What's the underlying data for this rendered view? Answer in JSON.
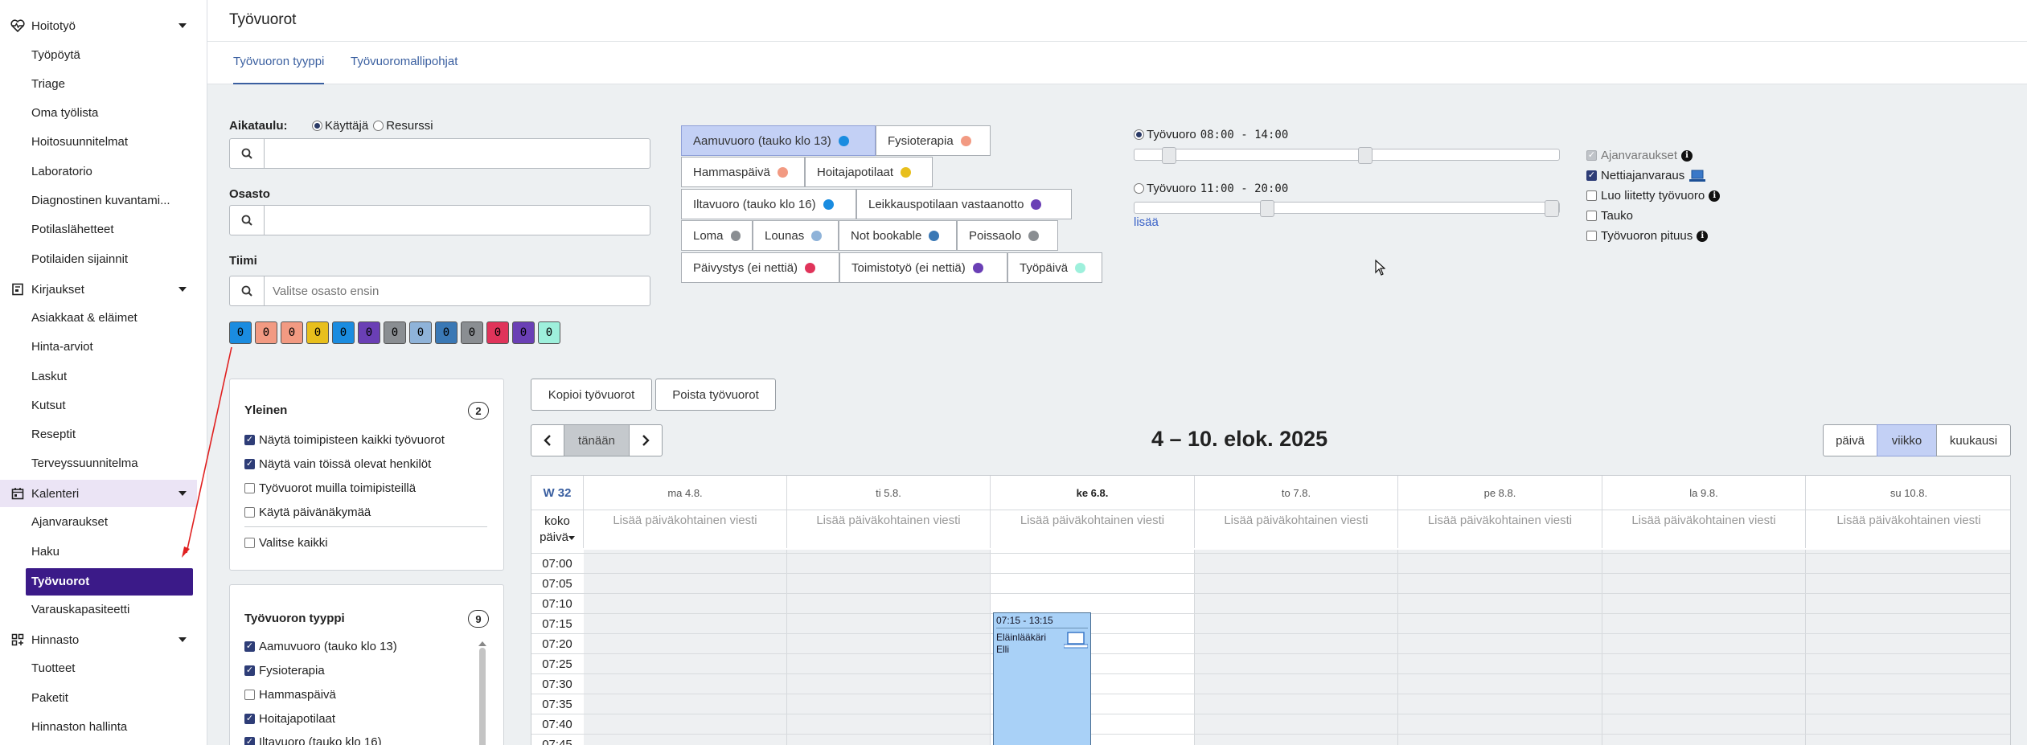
{
  "sidebar": {
    "sections": [
      {
        "label": "Hoitotyö",
        "icon": "heart-pulse-icon"
      },
      {
        "label": "Kirjaukset",
        "icon": "notebook-icon"
      },
      {
        "label": "Kalenteri",
        "icon": "calendar-icon"
      },
      {
        "label": "Hinnasto",
        "icon": "grid-icon"
      }
    ],
    "hoitotyo_items": [
      "Työpöytä",
      "Triage",
      "Oma työlista",
      "Hoitosuunnitelmat",
      "Laboratorio",
      "Diagnostinen kuvantami...",
      "Potilaslähetteet",
      "Potilaiden sijainnit"
    ],
    "kirjaukset_items": [
      "Asiakkaat & eläimet",
      "Hinta-arviot",
      "Laskut",
      "Kutsut",
      "Reseptit",
      "Terveyssuunnitelma"
    ],
    "kalenteri_items": [
      "Ajanvaraukset",
      "Haku",
      "Työvuorot",
      "Varauskapasiteetti"
    ],
    "hinnasto_items": [
      "Tuotteet",
      "Paketit",
      "Hinnaston hallinta"
    ]
  },
  "header": {
    "title": "Työvuorot"
  },
  "tabs": [
    "Työvuoron tyyppi",
    "Työvuoromallipohjat"
  ],
  "filters": {
    "schedule_label": "Aikataulu:",
    "radio_user": "Käyttäjä",
    "radio_resource": "Resurssi",
    "search_value": "",
    "osasto_label": "Osasto",
    "osasto_value": "",
    "tiimi_label": "Tiimi",
    "tiimi_placeholder": "Valitse osasto ensin"
  },
  "swatches": [
    {
      "color": "#1a8ce0",
      "value": "0"
    },
    {
      "color": "#f29a82",
      "value": "0"
    },
    {
      "color": "#f29a82",
      "value": "0"
    },
    {
      "color": "#e8bf1c",
      "value": "0"
    },
    {
      "color": "#1a8ce0",
      "value": "0"
    },
    {
      "color": "#6a3fb5",
      "value": "0"
    },
    {
      "color": "#8a8e92",
      "value": "0"
    },
    {
      "color": "#8fb3d9",
      "value": "0"
    },
    {
      "color": "#3a78b5",
      "value": "0"
    },
    {
      "color": "#8a8e92",
      "value": "0"
    },
    {
      "color": "#e0345a",
      "value": "0"
    },
    {
      "color": "#6a3fb5",
      "value": "0"
    },
    {
      "color": "#9ef0dc",
      "value": "0"
    }
  ],
  "shift_types": [
    {
      "label": "Aamuvuoro (tauko klo 13)",
      "color": "#1a8ce0"
    },
    {
      "label": "Fysioterapia",
      "color": "#f29a82"
    },
    {
      "label": "Hammaspäivä",
      "color": "#f29a82"
    },
    {
      "label": "Hoitajapotilaat",
      "color": "#e8bf1c"
    },
    {
      "label": "Iltavuoro (tauko klo 16)",
      "color": "#1a8ce0"
    },
    {
      "label": "Leikkauspotilaan vastaanotto",
      "color": "#6a3fb5"
    },
    {
      "label": "Loma",
      "color": "#8a8e92"
    },
    {
      "label": "Lounas",
      "color": "#8fb3d9"
    },
    {
      "label": "Not bookable",
      "color": "#3a78b5"
    },
    {
      "label": "Poissaolo",
      "color": "#8a8e92"
    },
    {
      "label": "Päivystys (ei nettiä)",
      "color": "#e0345a"
    },
    {
      "label": "Toimistotyö (ei nettiä)",
      "color": "#6a3fb5"
    },
    {
      "label": "Työpäivä",
      "color": "#9ef0dc"
    }
  ],
  "shift_templates": [
    {
      "label": "Työvuoro",
      "time": "08:00 - 14:00",
      "selected": true
    },
    {
      "label": "Työvuoro",
      "time": "11:00 - 20:00",
      "selected": false
    }
  ],
  "more_link": "lisää",
  "options": [
    {
      "label": "Ajanvaraukset",
      "state": "disabled",
      "info": true
    },
    {
      "label": "Nettiajanvaraus",
      "state": "on",
      "info": false
    },
    {
      "label": "Luo liitetty työvuoro",
      "state": "off",
      "info": true
    },
    {
      "label": "Tauko",
      "state": "off",
      "info": false
    },
    {
      "label": "Työvuoron pituus",
      "state": "off",
      "info": true
    }
  ],
  "general_panel": {
    "title": "Yleinen",
    "count": "2",
    "items": [
      {
        "label": "Näytä toimipisteen kaikki työvuorot",
        "checked": true
      },
      {
        "label": "Näytä vain töissä olevat henkilöt",
        "checked": true
      },
      {
        "label": "Työvuorot muilla toimipisteillä",
        "checked": false
      },
      {
        "label": "Käytä päivänäkymää",
        "checked": false
      }
    ],
    "select_all": "Valitse kaikki"
  },
  "type_panel": {
    "title": "Työvuoron tyyppi",
    "count": "9",
    "items": [
      {
        "label": "Aamuvuoro (tauko klo 13)",
        "checked": true
      },
      {
        "label": "Fysioterapia",
        "checked": true
      },
      {
        "label": "Hammaspäivä",
        "checked": false
      },
      {
        "label": "Hoitajapotilaat",
        "checked": true
      },
      {
        "label": "Iltavuoro (tauko klo 16)",
        "checked": true
      }
    ]
  },
  "toolbar": {
    "copy": "Kopioi työvuorot",
    "delete": "Poista työvuorot",
    "today": "tänään",
    "range_title": "4 – 10. elok. 2025",
    "views": [
      "päivä",
      "viikko",
      "kuukausi"
    ]
  },
  "calendar": {
    "week": "W 32",
    "days": [
      "ma 4.8.",
      "ti 5.8.",
      "ke 6.8.",
      "to 7.8.",
      "pe 8.8.",
      "la 9.8.",
      "su 10.8."
    ],
    "allday_label": "koko päivä",
    "allday_text": "Lisää päiväkohtainen viesti",
    "times": [
      "07:00",
      "07:05",
      "07:10",
      "07:15",
      "07:20",
      "07:25",
      "07:30",
      "07:35",
      "07:40",
      "07:45"
    ],
    "event": {
      "time": "07:15 - 13:15",
      "title": "Eläinlääkäri Elli"
    }
  }
}
